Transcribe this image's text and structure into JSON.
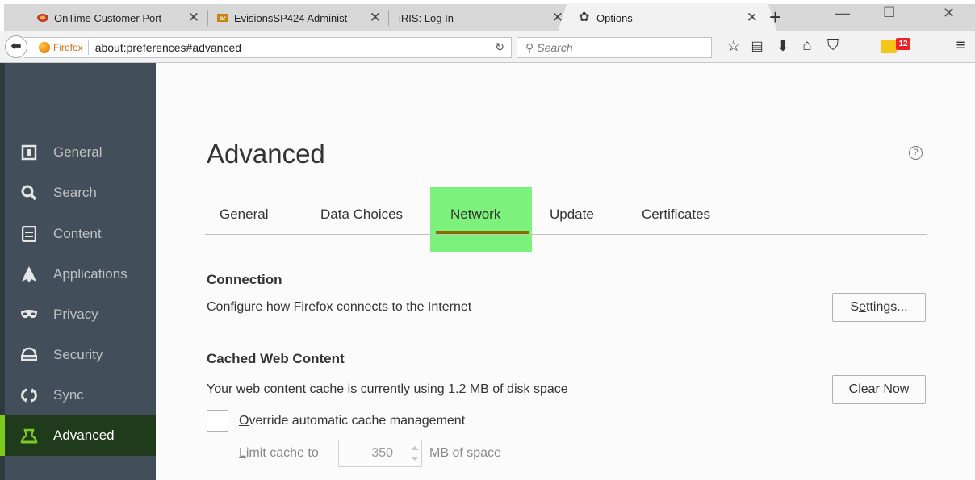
{
  "tabs": [
    {
      "title": "OnTime Customer Port",
      "icon": "ontime-icon"
    },
    {
      "title": "EvisionsSP424 Administ",
      "icon": "evisions-icon"
    },
    {
      "title": "iRIS: Log In",
      "icon": ""
    },
    {
      "title": "Options",
      "icon": "gear-icon",
      "active": true
    }
  ],
  "navbar": {
    "identity_label": "Firefox",
    "url": "about:preferences#advanced",
    "search_placeholder": "Search",
    "badge_count": "12"
  },
  "sidebar": {
    "items": [
      {
        "label": "General",
        "icon": "general-icon"
      },
      {
        "label": "Search",
        "icon": "search-icon"
      },
      {
        "label": "Content",
        "icon": "content-icon"
      },
      {
        "label": "Applications",
        "icon": "applications-icon"
      },
      {
        "label": "Privacy",
        "icon": "privacy-mask-icon"
      },
      {
        "label": "Security",
        "icon": "security-icon"
      },
      {
        "label": "Sync",
        "icon": "sync-icon"
      },
      {
        "label": "Advanced",
        "icon": "advanced-icon",
        "selected": true
      }
    ]
  },
  "main": {
    "title": "Advanced",
    "help": "?",
    "subtabs": [
      "General",
      "Data Choices",
      "Network",
      "Update",
      "Certificates"
    ],
    "selected_subtab": "Network",
    "connection": {
      "heading": "Connection",
      "description": "Configure how Firefox connects to the Internet",
      "button_prefix": "S",
      "button_accel": "e",
      "button_rest": "ttings..."
    },
    "cache": {
      "heading": "Cached Web Content",
      "description": "Your web content cache is currently using 1.2 MB of disk space",
      "button_accel": "C",
      "button_rest": "lear Now",
      "override_accel": "O",
      "override_rest": "verride automatic cache management",
      "limit_accel": "L",
      "limit_rest": "imit cache to",
      "limit_value": "350",
      "limit_unit": "MB of space"
    }
  },
  "colors": {
    "sidebar_bg": "#424f5a",
    "highlight_green": "#7cf27c",
    "selected_bg": "#1f3b1b"
  }
}
